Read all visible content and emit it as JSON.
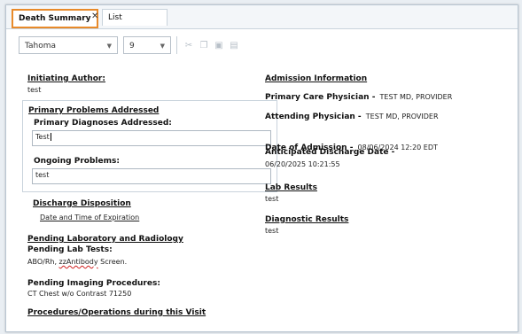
{
  "tabs": [
    {
      "label": "Death Summary",
      "close": "✕"
    },
    {
      "label": "List"
    }
  ],
  "toolbar": {
    "font": "Tahoma",
    "size": "9"
  },
  "left": {
    "initiating_author_label": "Initiating Author:",
    "initiating_author_value": "test",
    "ppa_heading": "Primary Problems Addressed",
    "primary_dx_label": "Primary Diagnoses Addressed:",
    "primary_dx_value": "Test",
    "ongoing_label": "Ongoing Problems:",
    "ongoing_value": "test",
    "discharge_disposition": "Discharge Disposition",
    "date_time_expiration": "Date and Time of Expiration",
    "pending_lab_rad": "Pending Laboratory and Radiology",
    "pending_lab_tests_label": "Pending Lab Tests:",
    "pending_lab_tests_value_prefix": "ABO/Rh, ",
    "pending_lab_tests_value_spell": "zzAntibody",
    "pending_lab_tests_value_suffix": " Screen.",
    "pending_imaging_label": "Pending Imaging Procedures:",
    "pending_imaging_value": "CT Chest w/o Contrast 71250",
    "procedures_heading": "Procedures/Operations during this Visit"
  },
  "right": {
    "admission_info": "Admission Information",
    "pcp_label": "Primary Care Physician -",
    "pcp_value": "TEST MD, PROVIDER",
    "attending_label": "Attending Physician -",
    "attending_value": "TEST MD, PROVIDER",
    "doa_label": "Date of Admission -",
    "doa_value": "08/06/2024 12:20 EDT",
    "anticipated_label": "Anticipated Discharge Date -",
    "anticipated_value": "06/20/2025 10:21:55",
    "lab_results_label": "Lab Results",
    "lab_results_value": "test",
    "diag_results_label": "Diagnostic Results",
    "diag_results_value": "test"
  },
  "colors": {
    "active_tab_border": "#e88a2a",
    "spell_underline": "#d02020"
  }
}
